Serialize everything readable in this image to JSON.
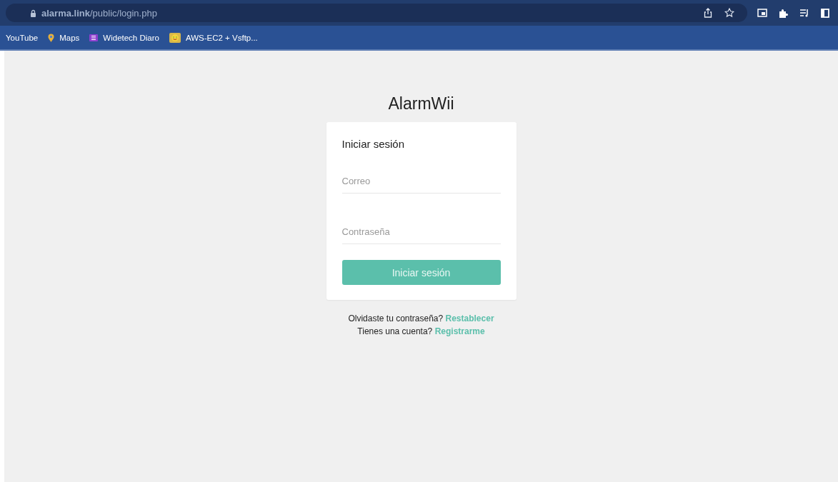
{
  "browser": {
    "url": "**alarma.link**/public/login.php",
    "bookmarks": [
      {
        "label": "YouTube",
        "kind": "plain"
      },
      {
        "label": "Maps",
        "kind": "pin"
      },
      {
        "label": "Widetech Diaro",
        "kind": "list"
      },
      {
        "label": "AWS-EC2 + Vsftp...",
        "kind": "face"
      }
    ]
  },
  "page": {
    "brand": "AlarmWii",
    "card": {
      "title": "Iniciar sesión",
      "fields": [
        {
          "placeholder": "Correo"
        },
        {
          "placeholder": "Contraseña"
        }
      ],
      "button": "Iniciar sesión"
    },
    "links": [
      {
        "text": "Olvidaste tu contraseña?",
        "link": "Restablecer"
      },
      {
        "text": "Tienes una cuenta?",
        "link": "Registrarme"
      }
    ]
  }
}
